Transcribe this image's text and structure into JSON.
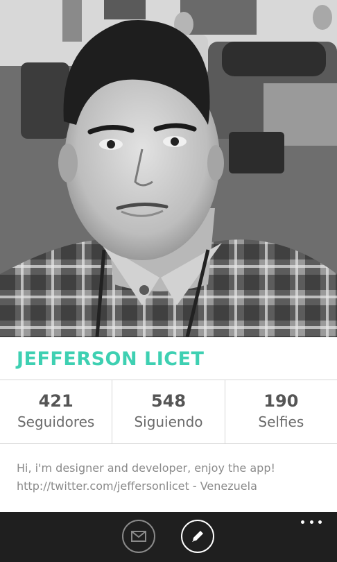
{
  "profile": {
    "name": "JEFFERSON LICET",
    "accent_color": "#3ed0b2",
    "photo_icon": "profile-photo"
  },
  "stats": [
    {
      "value": "421",
      "label": "Seguidores"
    },
    {
      "value": "548",
      "label": "Siguiendo"
    },
    {
      "value": "190",
      "label": "Selfies"
    }
  ],
  "bio": {
    "line1": "Hi, i'm designer and developer, enjoy the app!",
    "line2": "http://twitter.com/jeffersonlicet - Venezuela"
  },
  "appbar": {
    "buttons": [
      {
        "icon": "mail-icon",
        "state": "disabled"
      },
      {
        "icon": "edit-icon",
        "state": "enabled"
      }
    ],
    "more_icon": "more-icon",
    "background": "#1f1f1f"
  }
}
